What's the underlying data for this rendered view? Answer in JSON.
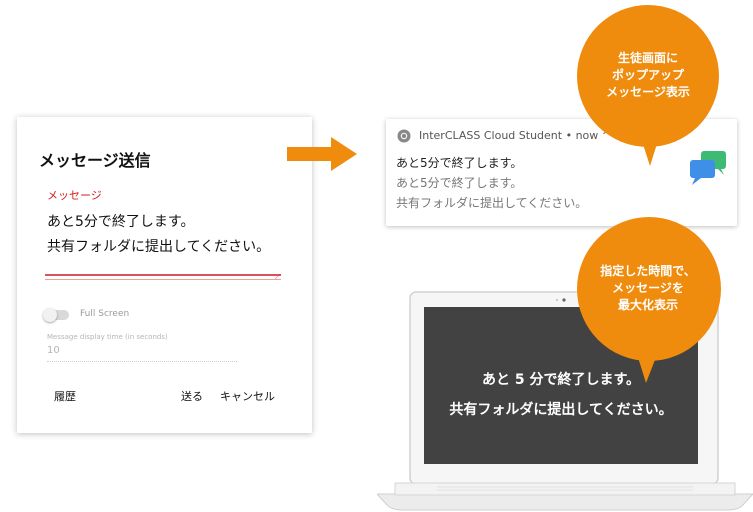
{
  "dialog": {
    "title": "メッセージ送信",
    "message_label": "メッセージ",
    "message_line1": "あと5分で終了します。",
    "message_line2": "共有フォルダに提出してください。",
    "fullscreen_label": "Full Screen",
    "display_time_label": "Message display time (in seconds)",
    "display_time_value": "10",
    "history_button": "履歴",
    "send_button": "送る",
    "cancel_button": "キャンセル"
  },
  "notification": {
    "app_line": "InterCLASS Cloud Student • now ^",
    "line1": "あと5分で終了します。",
    "line2": "あと5分で終了します。",
    "line3": "共有フォルダに提出してください。"
  },
  "laptop_screen": {
    "line1": "あと 5 分で終了します。",
    "line2": "共有フォルダに提出してください。"
  },
  "callouts": {
    "popup": [
      "生徒画面に",
      "ポップアップ",
      "メッセージ表示"
    ],
    "maximize": [
      "指定した時間で、",
      "メッセージを",
      "最大化表示"
    ]
  },
  "colors": {
    "accent_orange": "#ef8c0e",
    "label_red": "#d61f1f",
    "screen_dark": "#424242",
    "chat_green": "#3dbb74",
    "chat_blue": "#3f8ee8"
  },
  "icons": [
    "chrome-icon",
    "chat-bubbles-icon",
    "arrow-right-icon",
    "toggle-icon"
  ]
}
